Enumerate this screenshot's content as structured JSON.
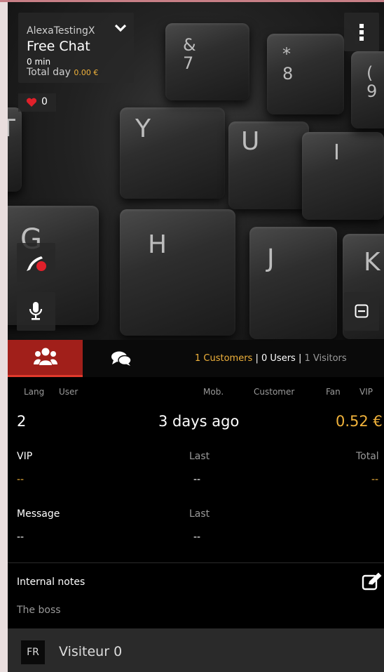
{
  "header": {
    "username": "AlexaTestingX",
    "chat_type": "Free Chat",
    "duration": "0 min",
    "total_day_label": "Total day",
    "total_day_value": "0.00 €",
    "likes": "0"
  },
  "icons": {
    "dropdown": "chevron-down-icon",
    "menu": "more-vert-icon",
    "camera": "camera-off-icon",
    "mic": "mic-icon",
    "minimize": "minimize-icon",
    "users": "users-icon",
    "chat": "comments-icon",
    "edit": "edit-icon",
    "heart": "heart-icon"
  },
  "tabs": {
    "customers": "1 Customers",
    "users": "0 Users",
    "visitors": "1 Visitors",
    "separator": "|"
  },
  "table_headers": {
    "lang": "Lang",
    "user": "User",
    "mob": "Mob.",
    "customer": "Customer",
    "fan": "Fan",
    "vip": "VIP"
  },
  "summary": {
    "lang_value": "2",
    "last_seen": "3 days ago",
    "amount": "0.52 €"
  },
  "vip": {
    "label": "VIP",
    "value": "--",
    "last_label": "Last",
    "last_value": "--",
    "total_label": "Total",
    "total_value": "--"
  },
  "message": {
    "label": "Message",
    "value": "--",
    "last_label": "Last",
    "last_value": "--"
  },
  "notes": {
    "title": "Internal notes",
    "text": "The boss"
  },
  "visitor": {
    "lang": "FR",
    "name": "Visiteur 0"
  },
  "colors": {
    "accent_red": "#a11f1a",
    "accent_orange": "#f0b23b",
    "heart_red": "#e0202a"
  }
}
